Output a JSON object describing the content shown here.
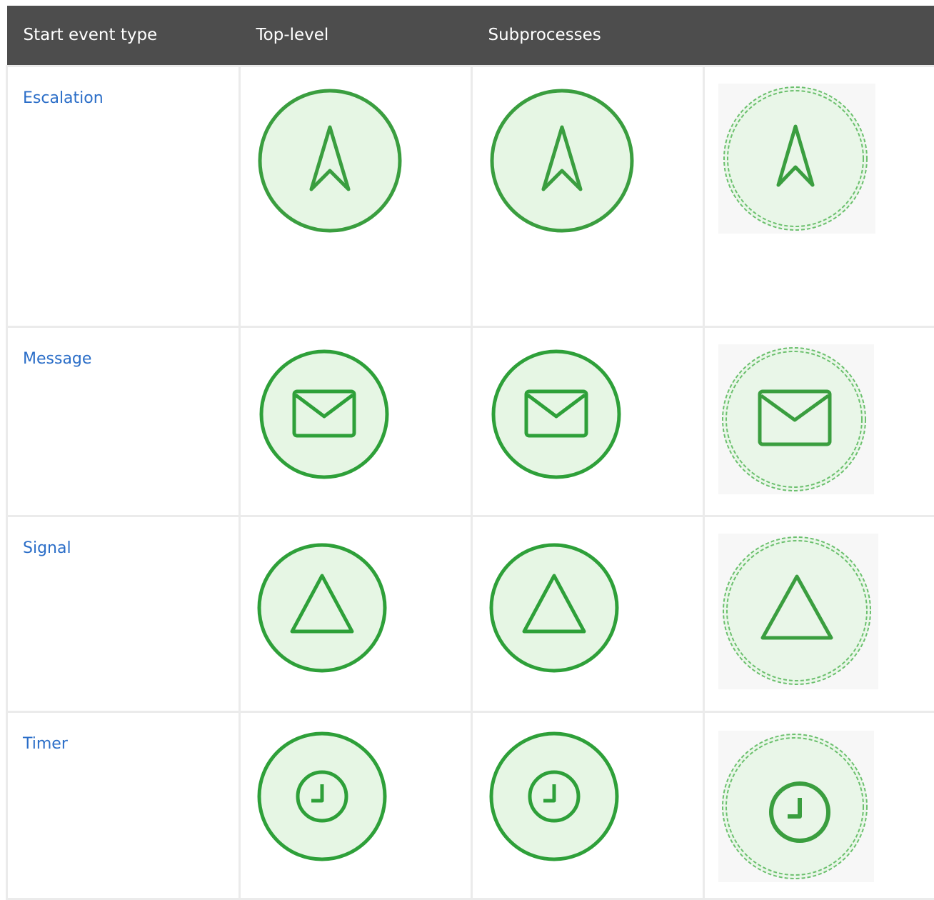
{
  "table": {
    "headers": [
      "Start event type",
      "Top-level",
      "Subprocesses",
      ""
    ],
    "rows": [
      {
        "label": "Escalation",
        "icon": "escalation-icon"
      },
      {
        "label": "Message",
        "icon": "message-icon"
      },
      {
        "label": "Signal",
        "icon": "signal-icon"
      },
      {
        "label": "Timer",
        "icon": "timer-icon"
      }
    ]
  },
  "colors": {
    "header_bg": "#4d4d4d",
    "link": "#2b6ec8",
    "stroke": "#3a9e3f",
    "fill": "#e6f6e4"
  }
}
